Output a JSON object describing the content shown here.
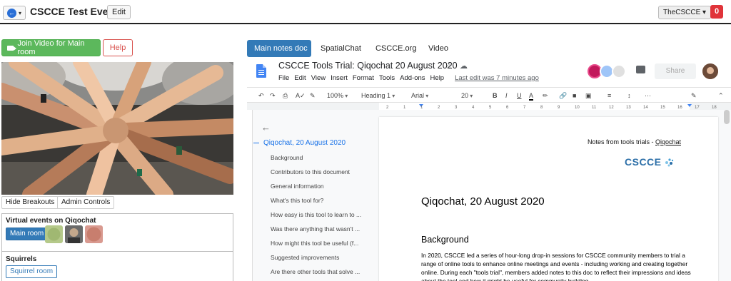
{
  "topbar": {
    "event_title": "CSCCE Test Event",
    "edit_label": "Edit",
    "user_label": "TheCSCCE",
    "notification_count": "0"
  },
  "left": {
    "join_video_label": "Join Video for Main room",
    "help_label": "Help",
    "hide_breakouts_label": "Hide Breakouts",
    "admin_controls_label": "Admin Controls",
    "virtual_events_title": "Virtual events on Qiqochat",
    "main_room_label": "Main room",
    "squirrels_title": "Squirrels",
    "squirrel_room_label": "Squirrel room"
  },
  "tabs": [
    {
      "label": "Main notes doc",
      "active": true
    },
    {
      "label": "SpatialChat",
      "active": false
    },
    {
      "label": "CSCCE.org",
      "active": false
    },
    {
      "label": "Video",
      "active": false
    }
  ],
  "gdoc": {
    "title": "CSCCE Tools Trial: Qiqochat 20 August 2020",
    "menu": [
      "File",
      "Edit",
      "View",
      "Insert",
      "Format",
      "Tools",
      "Add-ons",
      "Help"
    ],
    "last_edit": "Last edit was 7 minutes ago",
    "share_label": "Share",
    "toolbar": {
      "zoom": "100%",
      "style": "Heading 1",
      "font": "Arial",
      "size": "20"
    },
    "ruler_marks": [
      "2",
      "1",
      "1",
      "2",
      "3",
      "4",
      "5",
      "6",
      "7",
      "8",
      "9",
      "10",
      "11",
      "12",
      "13",
      "14",
      "15",
      "16",
      "17",
      "18"
    ],
    "outline": {
      "title": "Qiqochat, 20 August 2020",
      "items": [
        "Background",
        "Contributors to this document",
        "General information",
        "What's this tool for?",
        "How easy is this tool to learn to ...",
        "Was there anything that wasn't ...",
        "How might this tool be useful (f...",
        "Suggested improvements",
        "Are there other tools that solve ..."
      ]
    },
    "page": {
      "note_prefix": "Notes from tools trials - ",
      "note_link": "Qiqochat",
      "logo_text": "CSCCE",
      "heading1": "Qiqochat, 20 August 2020",
      "heading2": "Background",
      "body": "In 2020, CSCCE led a series of hour-long drop-in sessions for CSCCE community members to trial a range of online tools to enhance online meetings and events - including working and creating together online. During each \"tools trial\", members added notes to this doc to reflect their impressions and ideas about the tool and how it might be useful for community building"
    }
  },
  "colors": {
    "join_green": "#5cb85c",
    "help_red": "#d9534f",
    "tab_blue": "#337ab7",
    "notif_red": "#e0343a",
    "docs_blue": "#4285f4"
  }
}
